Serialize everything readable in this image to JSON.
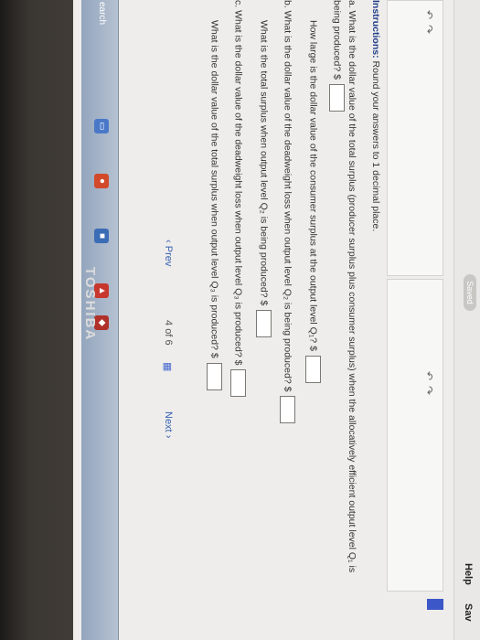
{
  "header": {
    "saved_label": "Saved",
    "help_label": "Help",
    "save_label": "Sav"
  },
  "instructions": {
    "prefix": "Instructions:",
    "text": "Round your answers to 1 decimal place."
  },
  "questions": {
    "a_line1": "a. What is the dollar value of the total surplus (producer surplus plus consumer surplus) when the allocatively efficient output level Q₁ is",
    "a_line2": "being produced? $",
    "a_sub": "How large is the dollar value of the consumer surplus at the output level Q₁? $",
    "b_line1": "b. What is the dollar value of the deadweight loss when output level Q₂ is being produced? $",
    "b_sub": "What is the total surplus when output level Q₂ is being produced? $",
    "c_line1": "c. What is the dollar value of the deadweight loss when output level Q₃ is produced? $",
    "c_sub": "What is the dollar value of the total surplus when output level Q₃ is produced? $"
  },
  "navigation": {
    "prev_label": "Prev",
    "current_page": "4",
    "of_label": "of",
    "total_pages": "6",
    "next_label": "Next"
  },
  "taskbar": {
    "search_label": "earch"
  },
  "brand": "TOSHIBA",
  "colors": {
    "accent": "#3c57c7",
    "link": "#355fb2",
    "instructions": "#1f3c8a"
  },
  "icons": [
    "undo-icon",
    "redo-icon",
    "grid-icon",
    "chevron-left-icon",
    "chevron-right-icon"
  ]
}
